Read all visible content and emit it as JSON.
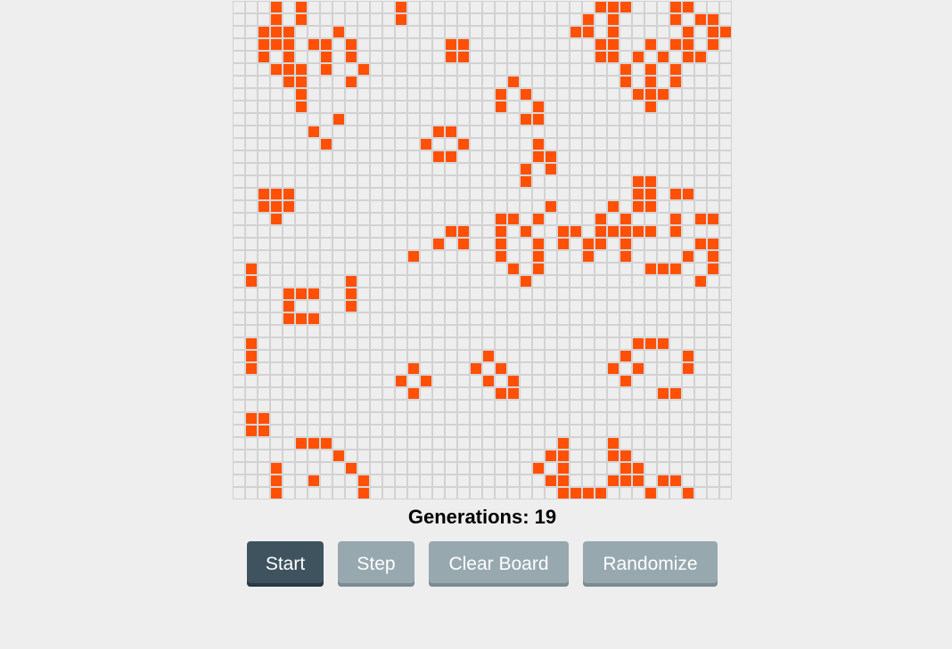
{
  "generation_label": "Generations: 19",
  "buttons": {
    "start": "Start",
    "step": "Step",
    "clear": "Clear Board",
    "randomize": "Randomize"
  },
  "colors": {
    "alive": "#ff5006",
    "dead": "#eeeeee",
    "grid_line": "#d2d2d2",
    "primary_button": "#3f535f",
    "secondary_button": "#97a8af"
  },
  "board": {
    "rows": 40,
    "cols": 40,
    "live_cells": [
      [
        0,
        3
      ],
      [
        0,
        5
      ],
      [
        0,
        13
      ],
      [
        0,
        29
      ],
      [
        0,
        30
      ],
      [
        0,
        31
      ],
      [
        0,
        35
      ],
      [
        0,
        36
      ],
      [
        1,
        3
      ],
      [
        1,
        5
      ],
      [
        1,
        13
      ],
      [
        1,
        28
      ],
      [
        1,
        30
      ],
      [
        1,
        35
      ],
      [
        1,
        37
      ],
      [
        1,
        38
      ],
      [
        2,
        2
      ],
      [
        2,
        3
      ],
      [
        2,
        4
      ],
      [
        2,
        8
      ],
      [
        2,
        27
      ],
      [
        2,
        28
      ],
      [
        2,
        30
      ],
      [
        2,
        36
      ],
      [
        2,
        38
      ],
      [
        2,
        39
      ],
      [
        3,
        2
      ],
      [
        3,
        3
      ],
      [
        3,
        4
      ],
      [
        3,
        6
      ],
      [
        3,
        7
      ],
      [
        3,
        9
      ],
      [
        3,
        17
      ],
      [
        3,
        18
      ],
      [
        3,
        29
      ],
      [
        3,
        30
      ],
      [
        3,
        33
      ],
      [
        3,
        35
      ],
      [
        3,
        36
      ],
      [
        3,
        38
      ],
      [
        4,
        2
      ],
      [
        4,
        4
      ],
      [
        4,
        7
      ],
      [
        4,
        9
      ],
      [
        4,
        17
      ],
      [
        4,
        18
      ],
      [
        4,
        29
      ],
      [
        4,
        30
      ],
      [
        4,
        32
      ],
      [
        4,
        34
      ],
      [
        4,
        36
      ],
      [
        4,
        37
      ],
      [
        5,
        3
      ],
      [
        5,
        4
      ],
      [
        5,
        5
      ],
      [
        5,
        7
      ],
      [
        5,
        10
      ],
      [
        5,
        31
      ],
      [
        5,
        33
      ],
      [
        5,
        35
      ],
      [
        6,
        4
      ],
      [
        6,
        5
      ],
      [
        6,
        9
      ],
      [
        6,
        22
      ],
      [
        6,
        31
      ],
      [
        6,
        33
      ],
      [
        6,
        35
      ],
      [
        7,
        5
      ],
      [
        7,
        21
      ],
      [
        7,
        23
      ],
      [
        7,
        32
      ],
      [
        7,
        33
      ],
      [
        7,
        34
      ],
      [
        8,
        5
      ],
      [
        8,
        21
      ],
      [
        8,
        24
      ],
      [
        8,
        33
      ],
      [
        9,
        8
      ],
      [
        9,
        23
      ],
      [
        9,
        24
      ],
      [
        10,
        6
      ],
      [
        10,
        16
      ],
      [
        10,
        17
      ],
      [
        11,
        7
      ],
      [
        11,
        15
      ],
      [
        11,
        18
      ],
      [
        11,
        24
      ],
      [
        12,
        16
      ],
      [
        12,
        17
      ],
      [
        12,
        24
      ],
      [
        12,
        25
      ],
      [
        13,
        23
      ],
      [
        13,
        25
      ],
      [
        14,
        23
      ],
      [
        14,
        32
      ],
      [
        14,
        33
      ],
      [
        15,
        2
      ],
      [
        15,
        3
      ],
      [
        15,
        4
      ],
      [
        15,
        32
      ],
      [
        15,
        33
      ],
      [
        15,
        35
      ],
      [
        15,
        36
      ],
      [
        16,
        2
      ],
      [
        16,
        3
      ],
      [
        16,
        4
      ],
      [
        16,
        25
      ],
      [
        16,
        30
      ],
      [
        16,
        32
      ],
      [
        16,
        33
      ],
      [
        17,
        3
      ],
      [
        17,
        21
      ],
      [
        17,
        22
      ],
      [
        17,
        24
      ],
      [
        17,
        29
      ],
      [
        17,
        31
      ],
      [
        17,
        35
      ],
      [
        17,
        37
      ],
      [
        17,
        38
      ],
      [
        18,
        17
      ],
      [
        18,
        18
      ],
      [
        18,
        21
      ],
      [
        18,
        23
      ],
      [
        18,
        26
      ],
      [
        18,
        27
      ],
      [
        18,
        29
      ],
      [
        18,
        30
      ],
      [
        18,
        31
      ],
      [
        18,
        32
      ],
      [
        18,
        33
      ],
      [
        18,
        35
      ],
      [
        19,
        16
      ],
      [
        19,
        18
      ],
      [
        19,
        21
      ],
      [
        19,
        24
      ],
      [
        19,
        26
      ],
      [
        19,
        28
      ],
      [
        19,
        29
      ],
      [
        19,
        31
      ],
      [
        19,
        37
      ],
      [
        19,
        38
      ],
      [
        20,
        14
      ],
      [
        20,
        21
      ],
      [
        20,
        24
      ],
      [
        20,
        28
      ],
      [
        20,
        31
      ],
      [
        20,
        36
      ],
      [
        20,
        38
      ],
      [
        21,
        1
      ],
      [
        21,
        22
      ],
      [
        21,
        24
      ],
      [
        21,
        33
      ],
      [
        21,
        34
      ],
      [
        21,
        35
      ],
      [
        21,
        38
      ],
      [
        22,
        1
      ],
      [
        22,
        9
      ],
      [
        22,
        23
      ],
      [
        22,
        37
      ],
      [
        23,
        4
      ],
      [
        23,
        5
      ],
      [
        23,
        6
      ],
      [
        23,
        9
      ],
      [
        24,
        4
      ],
      [
        24,
        9
      ],
      [
        25,
        4
      ],
      [
        25,
        5
      ],
      [
        25,
        6
      ],
      [
        27,
        1
      ],
      [
        27,
        32
      ],
      [
        27,
        33
      ],
      [
        27,
        34
      ],
      [
        28,
        1
      ],
      [
        28,
        20
      ],
      [
        28,
        31
      ],
      [
        28,
        36
      ],
      [
        29,
        1
      ],
      [
        29,
        14
      ],
      [
        29,
        19
      ],
      [
        29,
        21
      ],
      [
        29,
        30
      ],
      [
        29,
        32
      ],
      [
        29,
        36
      ],
      [
        30,
        13
      ],
      [
        30,
        15
      ],
      [
        30,
        20
      ],
      [
        30,
        22
      ],
      [
        30,
        31
      ],
      [
        31,
        14
      ],
      [
        31,
        21
      ],
      [
        31,
        22
      ],
      [
        31,
        34
      ],
      [
        31,
        35
      ],
      [
        33,
        1
      ],
      [
        33,
        2
      ],
      [
        34,
        1
      ],
      [
        34,
        2
      ],
      [
        35,
        5
      ],
      [
        35,
        6
      ],
      [
        35,
        7
      ],
      [
        35,
        26
      ],
      [
        35,
        30
      ],
      [
        36,
        8
      ],
      [
        36,
        25
      ],
      [
        36,
        26
      ],
      [
        36,
        30
      ],
      [
        36,
        31
      ],
      [
        37,
        3
      ],
      [
        37,
        9
      ],
      [
        37,
        24
      ],
      [
        37,
        26
      ],
      [
        37,
        31
      ],
      [
        37,
        32
      ],
      [
        38,
        3
      ],
      [
        38,
        6
      ],
      [
        38,
        10
      ],
      [
        38,
        25
      ],
      [
        38,
        26
      ],
      [
        38,
        30
      ],
      [
        38,
        31
      ],
      [
        38,
        32
      ],
      [
        38,
        34
      ],
      [
        38,
        35
      ],
      [
        39,
        3
      ],
      [
        39,
        10
      ],
      [
        39,
        26
      ],
      [
        39,
        27
      ],
      [
        39,
        28
      ],
      [
        39,
        29
      ],
      [
        39,
        33
      ],
      [
        39,
        36
      ]
    ]
  }
}
